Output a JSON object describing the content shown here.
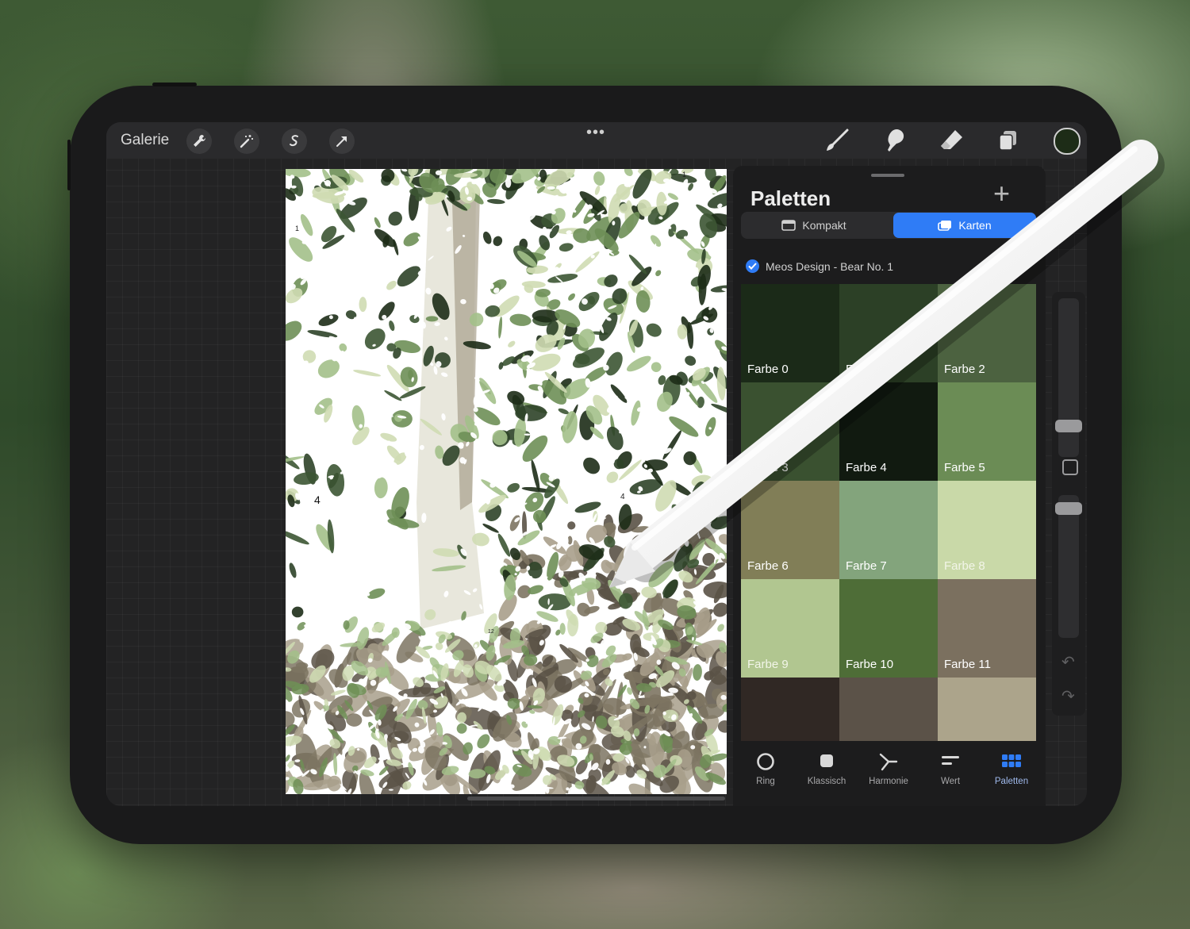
{
  "toolbar": {
    "gallery_label": "Galerie",
    "left_tools": [
      "wrench-icon",
      "magic-wand-icon",
      "selection-icon",
      "transform-arrow-icon"
    ],
    "more_label": "•••",
    "right_tools": [
      "brush-icon",
      "smudge-icon",
      "eraser-icon",
      "layers-icon"
    ],
    "current_color": "#1d2c17"
  },
  "canvas": {
    "numbers": [
      "1",
      "1",
      "4",
      "4",
      "12"
    ],
    "colors": [
      "#1d2c17",
      "#2e4328",
      "#3c5533",
      "#6e8f56",
      "#a3c08a",
      "#cfdcb3",
      "#7d7462",
      "#5a5246",
      "#a89f8b",
      "#eef0e6"
    ]
  },
  "panel": {
    "title": "Paletten",
    "add_label": "+",
    "view_compact": "Kompakt",
    "view_cards": "Karten",
    "active_view": "Karten",
    "palette_name": "Meos Design - Bear No. 1",
    "swatches": [
      {
        "label": "Farbe 0",
        "color": "#1b2a18"
      },
      {
        "label": "Farbe 1",
        "color": "#2c4026"
      },
      {
        "label": "Farbe 2",
        "color": "#4c6240"
      },
      {
        "label": "Farbe 3",
        "color": "#3a5130"
      },
      {
        "label": "Farbe 4",
        "color": "#111a10"
      },
      {
        "label": "Farbe 5",
        "color": "#6b8c55"
      },
      {
        "label": "Farbe 6",
        "color": "#817e57"
      },
      {
        "label": "Farbe 7",
        "color": "#83a47c"
      },
      {
        "label": "Farbe 8",
        "color": "#c9d9a8"
      },
      {
        "label": "Farbe 9",
        "color": "#b1c690"
      },
      {
        "label": "Farbe 10",
        "color": "#4e6d37"
      },
      {
        "label": "Farbe 11",
        "color": "#7b705f"
      },
      {
        "label": "",
        "color": "#302824"
      },
      {
        "label": "",
        "color": "#5b5248"
      },
      {
        "label": "",
        "color": "#aca48b"
      }
    ]
  },
  "tabs": [
    {
      "label": "Ring",
      "icon": "ring-icon",
      "active": false
    },
    {
      "label": "Klassisch",
      "icon": "classic-icon",
      "active": false
    },
    {
      "label": "Harmonie",
      "icon": "harmony-icon",
      "active": false
    },
    {
      "label": "Wert",
      "icon": "value-icon",
      "active": false
    },
    {
      "label": "Paletten",
      "icon": "palettes-icon",
      "active": true
    }
  ],
  "colors": {
    "accent": "#2f7cf6",
    "panel_bg": "#1c1c1d",
    "device": "#1a1a1b"
  }
}
